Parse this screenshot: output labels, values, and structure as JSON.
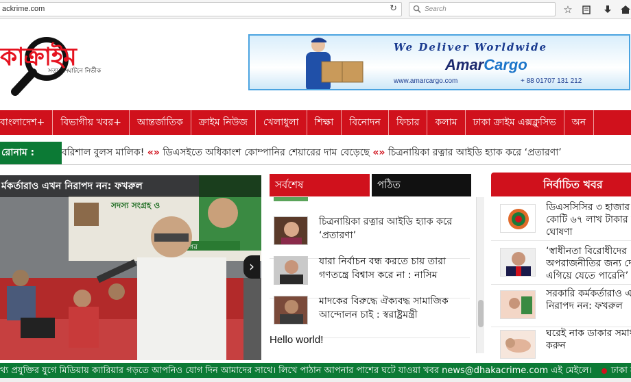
{
  "browser": {
    "url": "ackrime.com",
    "search_placeholder": "Search"
  },
  "logo": {
    "title": "কাক্রাইম",
    "tagline": "সত্য উদ্ঘাটনে নির্ভীক"
  },
  "banner": {
    "headline": "We Deliver Worldwide",
    "brand_part1": "Amar",
    "brand_part2": "Cargo",
    "url": "www.amarcargo.com",
    "phone": "+ 88 01707 131 212"
  },
  "nav": {
    "items": [
      "বাংলাদেশ+",
      "বিভাগীয় খবর+",
      "আন্তর্জাতিক",
      "ক্রাইম নিউজ",
      "খেলাধুলা",
      "শিক্ষা",
      "বিনোদন",
      "ফিচার",
      "কলাম",
      "ঢাকা ক্রাইম এক্সক্লুসিভ",
      "অন"
    ]
  },
  "ticker": {
    "label": "রোনাম :",
    "items": [
      "বরিশাল বুলস মালিক!",
      "ডিএসইতে অধিকাংশ কোম্পানির শেয়ারের দাম বেড়েছে",
      "চিত্রনায়িকা রত্নার আইডি হ্যাক করে ‘প্রতারণা’"
    ],
    "separator": "«»"
  },
  "featured": {
    "title": "র্মকর্তারাও এখন নিরাপদ নন: ফখরুল",
    "banner_text": "সদস্য সংগ্রহ ও",
    "banner_text2": "মহানগর"
  },
  "tabs": {
    "latest": "সর্বশেষ",
    "read": "পঠিত"
  },
  "latest_list": [
    "চিত্রনায়িকা রত্নার আইডি হ্যাক করে ‘প্রতারণা’",
    "যারা নির্বাচন বন্ধ করতে চায় তারা গণতন্ত্রে বিশ্বাস করে না : নাসিম",
    "মাদকের বিরুদ্ধে ঐক্যবদ্ধ সামাজিক আন্দোলন চাই : স্বরাষ্ট্রমন্ত্রী"
  ],
  "hello": "Hello world!",
  "selected": {
    "title": "নির্বাচিত খবর",
    "items": [
      [
        "ডিএসসিসির ৩ হাজার",
        "কোটি ৬৭ লাখ টাকার ব",
        "ঘোষণা"
      ],
      [
        "‘স্বাধীনতা বিরোধীদের",
        "অপরাজনীতির জন্য দে",
        "এগিয়ে যেতে পারেনি’"
      ],
      [
        "সরকারি কর্মকর্তারাও এ",
        "নিরাপদ নন: ফখরুল"
      ],
      [
        "ঘরেই নাক ডাকার সমাধ",
        "করুন"
      ]
    ]
  },
  "bottom_ticker": {
    "text": "থ্য প্রযুক্তির যুগে মিডিয়ায় ক্যারিয়ার গড়তে আপনিও যোগ দিন আমাদের সাথে। লিখে পাঠান আপনার পাশের ঘটে যাওয়া খবর news@dhakacrime.com এই মেইলে।",
    "next": "ঢাকা ক্রাইম ড"
  },
  "colors": {
    "brand_red": "#d0111c",
    "ticker_green": "#0c7a35",
    "read_tab": "#111111"
  }
}
